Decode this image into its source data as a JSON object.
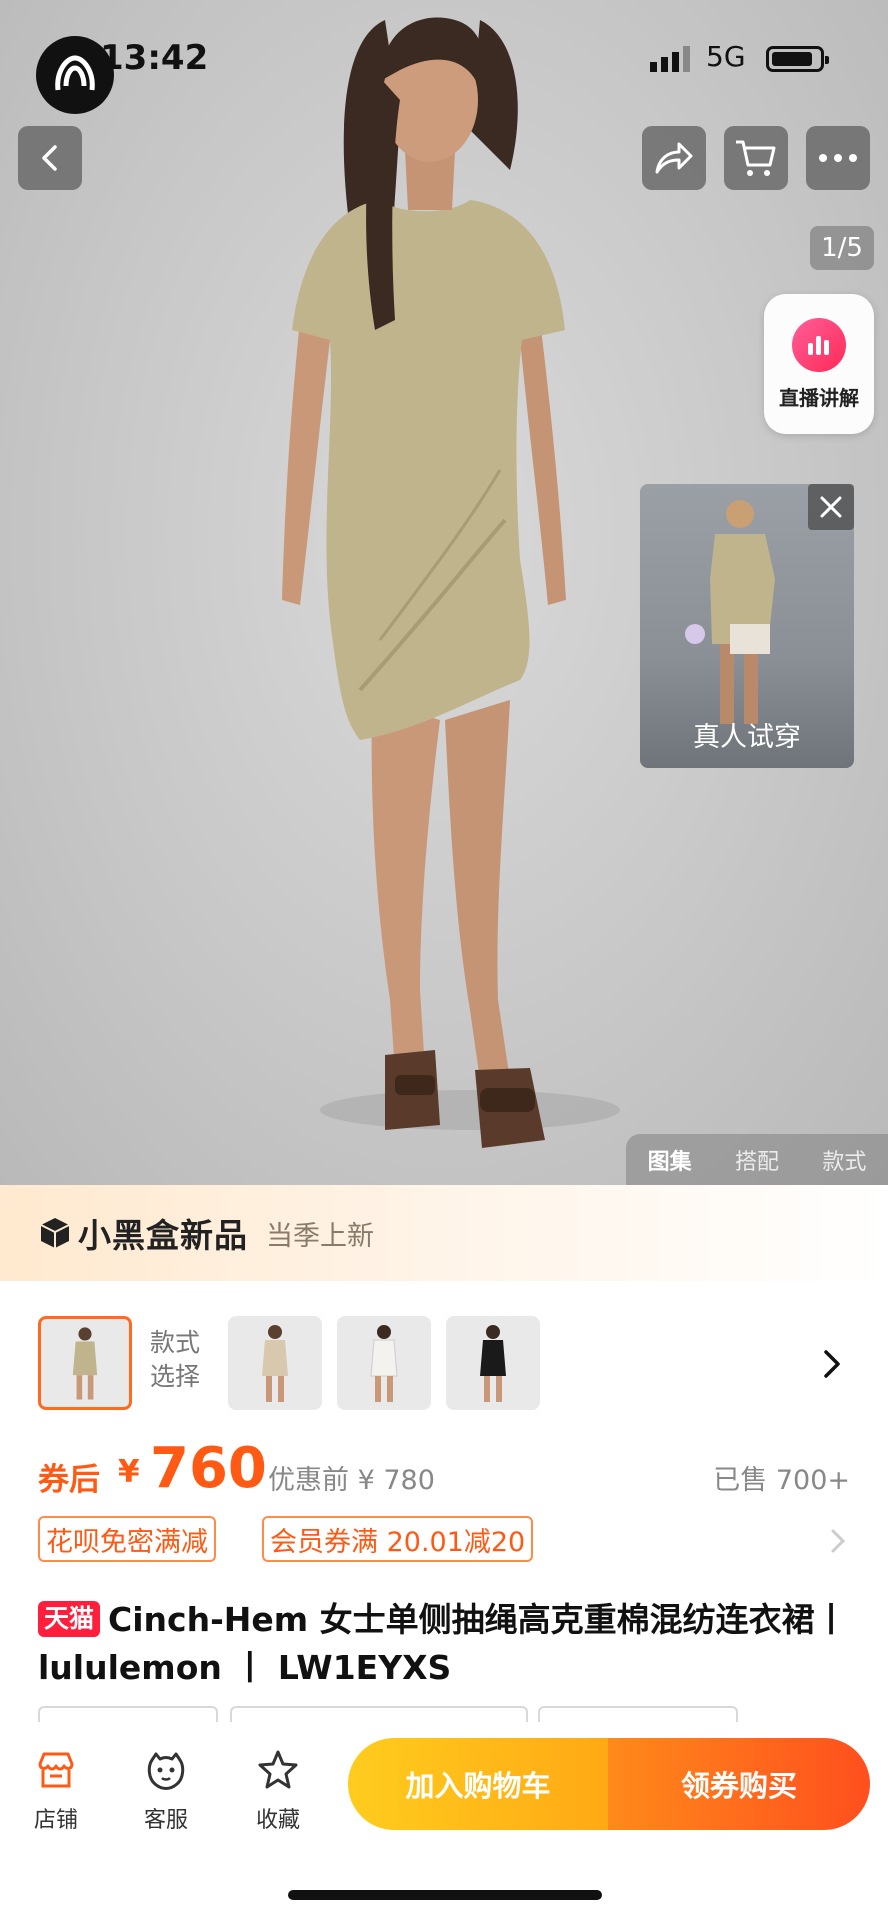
{
  "status_bar": {
    "time": "13:42",
    "network": "5G"
  },
  "gallery": {
    "counter": "1/5",
    "live_label": "直播讲解",
    "tryon_label": "真人试穿",
    "tabs": [
      "图集",
      "搭配",
      "款式"
    ],
    "active_tab": "图集"
  },
  "banner": {
    "title": "小黑盒新品",
    "subtitle": "当季上新"
  },
  "style_selector": {
    "label": "款式选择"
  },
  "price": {
    "after_label": "券后",
    "currency": "¥",
    "value": "760",
    "before": "优惠前 ¥ 780",
    "sold": "已售 700+"
  },
  "promos": [
    "花呗免密满减",
    "会员券满 20.01减20"
  ],
  "product": {
    "badge": "天猫",
    "title": "Cinch-Hem 女士单侧抽绳高克重棉混纺连衣裙丨 lululemon 丨 LW1EYXS"
  },
  "bottom_nav": {
    "shop": "店铺",
    "service": "客服",
    "favorite": "收藏",
    "add_cart": "加入购物车",
    "buy": "领券购买"
  },
  "colors": {
    "accent": "#ff5a14",
    "cta_left": "#ffb815",
    "cta_right": "#ff5a1e",
    "tmall": "#ff1f3c"
  }
}
